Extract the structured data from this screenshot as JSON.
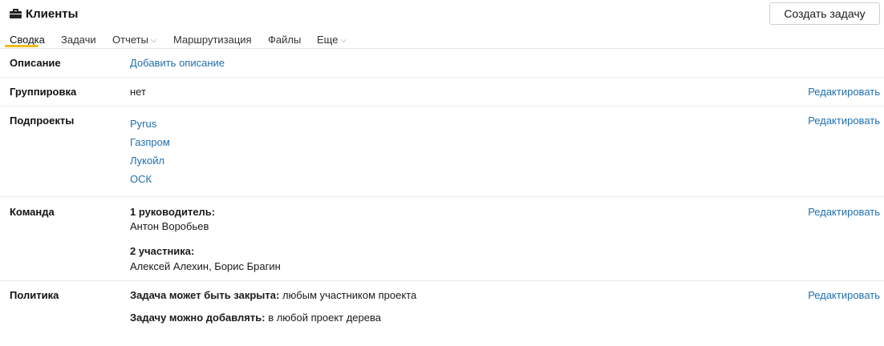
{
  "header": {
    "title": "Клиенты",
    "icon": "briefcase-icon",
    "create_button": "Создать задачу"
  },
  "tabs": [
    {
      "label": "Сводка",
      "active": true,
      "dropdown": false
    },
    {
      "label": "Задачи",
      "active": false,
      "dropdown": false
    },
    {
      "label": "Отчеты",
      "active": false,
      "dropdown": true
    },
    {
      "label": "Маршрутизация",
      "active": false,
      "dropdown": false
    },
    {
      "label": "Файлы",
      "active": false,
      "dropdown": false
    },
    {
      "label": "Еще",
      "active": false,
      "dropdown": true
    }
  ],
  "tab_chevron": "⌵",
  "sections": {
    "description": {
      "label": "Описание",
      "add_link": "Добавить описание"
    },
    "grouping": {
      "label": "Группировка",
      "value": "нет",
      "edit": "Редактировать"
    },
    "subprojects": {
      "label": "Подпроекты",
      "items": [
        "Pyrus",
        "Газпром",
        "Лукойл",
        "ОСК"
      ],
      "edit": "Редактировать"
    },
    "team": {
      "label": "Команда",
      "managers_heading": "1 руководитель:",
      "managers": "Антон Воробьев",
      "members_heading": "2 участника:",
      "members": "Алексей Алехин, Борис Брагин",
      "edit": "Редактировать"
    },
    "policy": {
      "label": "Политика",
      "close_label": "Задача может быть закрыта:",
      "close_value": "любым участником проекта",
      "add_label": "Задачу можно добавлять:",
      "add_value": "в любой проект дерева",
      "edit": "Редактировать"
    }
  },
  "colors": {
    "link": "#1f6fae",
    "tab_accent": "#f3bd1a",
    "divider": "#ebebeb"
  }
}
